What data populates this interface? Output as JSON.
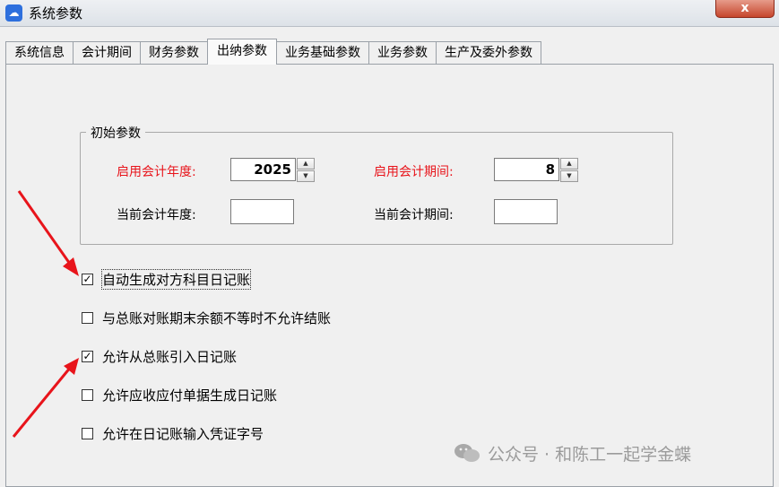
{
  "window": {
    "title": "系统参数",
    "close_label": "x"
  },
  "tabs": [
    {
      "label": "系统信息"
    },
    {
      "label": "会计期间"
    },
    {
      "label": "财务参数"
    },
    {
      "label": "出纳参数",
      "active": true
    },
    {
      "label": "业务基础参数"
    },
    {
      "label": "业务参数"
    },
    {
      "label": "生产及委外参数"
    }
  ],
  "initial_params": {
    "legend": "初始参数",
    "start_year_label": "启用会计年度:",
    "start_year_value": "2025",
    "start_period_label": "启用会计期间:",
    "start_period_value": "8",
    "current_year_label": "当前会计年度:",
    "current_year_value": "",
    "current_period_label": "当前会计期间:",
    "current_period_value": ""
  },
  "options": [
    {
      "label": "自动生成对方科目日记账",
      "checked": true
    },
    {
      "label": "与总账对账期末余额不等时不允许结账",
      "checked": false
    },
    {
      "label": "允许从总账引入日记账",
      "checked": true
    },
    {
      "label": "允许应收应付单据生成日记账",
      "checked": false
    },
    {
      "label": "允许在日记账输入凭证字号",
      "checked": false
    }
  ],
  "watermark": {
    "text": "公众号 · 和陈工一起学金蝶"
  },
  "colors": {
    "required_label": "#e8141b",
    "annotation_arrow": "#e8141b"
  }
}
